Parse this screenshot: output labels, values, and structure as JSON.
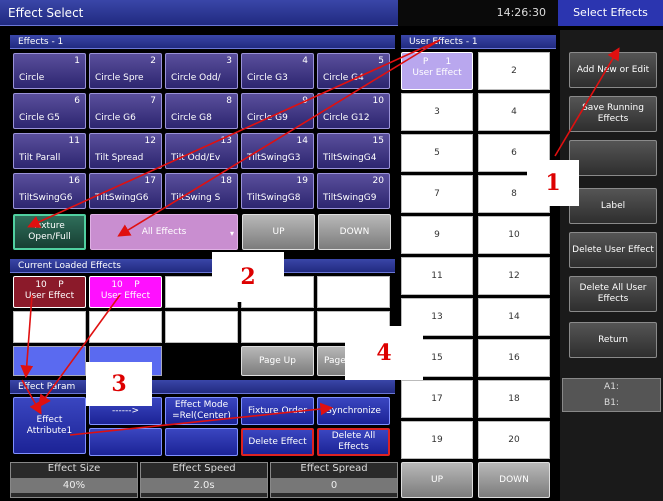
{
  "title": "Effect Select",
  "clock": "14:26:30",
  "title_tab": "Select Effects",
  "effects_header": "Effects - 1",
  "user_effects_header": "User Effects - 1",
  "effects": [
    {
      "num": "1",
      "name": "Circle"
    },
    {
      "num": "2",
      "name": "Circle Spre"
    },
    {
      "num": "3",
      "name": "Circle Odd/"
    },
    {
      "num": "4",
      "name": "Circle G3"
    },
    {
      "num": "5",
      "name": "Circle G4"
    },
    {
      "num": "6",
      "name": "Circle G5"
    },
    {
      "num": "7",
      "name": "Circle G6"
    },
    {
      "num": "8",
      "name": "Circle G8"
    },
    {
      "num": "9",
      "name": "Circle G9"
    },
    {
      "num": "10",
      "name": "Circle G12"
    },
    {
      "num": "11",
      "name": "Tilt Parall"
    },
    {
      "num": "12",
      "name": "Tilt Spread"
    },
    {
      "num": "13",
      "name": "Tilt Odd/Ev"
    },
    {
      "num": "14",
      "name": "TiltSwingG3"
    },
    {
      "num": "15",
      "name": "TiltSwingG4"
    },
    {
      "num": "16",
      "name": "TiltSwingG6"
    },
    {
      "num": "17",
      "name": "TiltSwingG6"
    },
    {
      "num": "18",
      "name": "TiltSwing S"
    },
    {
      "num": "19",
      "name": "TiltSwingG8"
    },
    {
      "num": "20",
      "name": "TiltSwingG9"
    }
  ],
  "fixture_btn": "Fixture Open/Full",
  "all_effects": "All Effects",
  "up": "UP",
  "down": "DOWN",
  "loaded_header": "Current Loaded Effects",
  "loaded": [
    {
      "num": "10",
      "flag": "P",
      "label": "User Effect"
    },
    {
      "num": "10",
      "flag": "P",
      "label": "User Effect"
    }
  ],
  "page_up": "Page Up",
  "page_down": "Page",
  "params_header": "Effect Param",
  "effect_attribute": "Effect Attribute1",
  "arrow_btn": "------>",
  "effect_mode": "Effect Mode =Rel(Center)",
  "fixture_order": "Fixture Order",
  "synchronize": "Synchronize",
  "delete_effect": "Delete Effect",
  "delete_all_effects": "Delete All Effects",
  "user_first": {
    "num": "1",
    "flag": "P",
    "label": "User Effect"
  },
  "user_nums": [
    "2",
    "3",
    "4",
    "5",
    "6",
    "7",
    "8",
    "9",
    "10",
    "11",
    "12",
    "13",
    "14",
    "15",
    "16",
    "17",
    "18",
    "19",
    "20"
  ],
  "side": {
    "add": "Add New or Edit",
    "save": "Save Running Effects",
    "label": "Label",
    "delete_user": "Delete User Effect",
    "delete_all_user": "Delete All User Effects",
    "return": "Return"
  },
  "status_a": "A1:",
  "status_b": "B1:",
  "bottom": [
    {
      "label": "Effect Size",
      "value": "40%"
    },
    {
      "label": "Effect Speed",
      "value": "2.0s"
    },
    {
      "label": "Effect Spread",
      "value": "0"
    }
  ],
  "annotations": [
    "1",
    "2",
    "3",
    "4"
  ],
  "colors": {
    "title_bar": "#2a3494",
    "effect_btn": "#3f3586",
    "user_selected": "#b9a7ee",
    "loaded_red": "#8b1a2a",
    "loaded_magenta": "#ff00ff",
    "all_effects": "#c98ed0",
    "arrow_red": "#e01010"
  }
}
